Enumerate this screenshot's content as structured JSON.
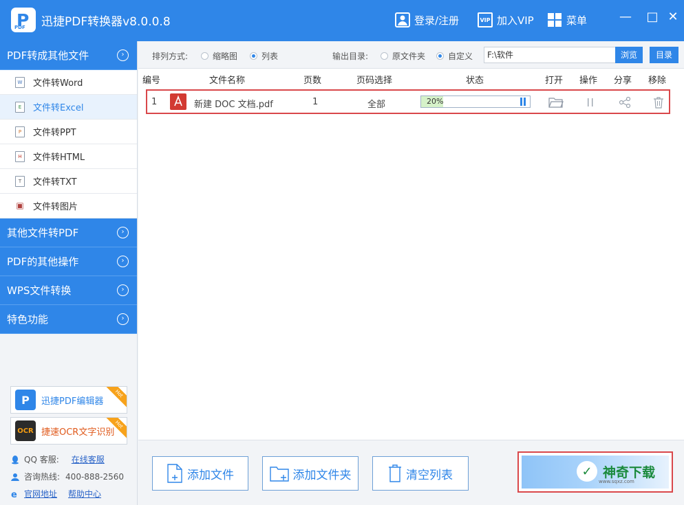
{
  "app": {
    "title": "迅捷PDF转换器v8.0.0.8",
    "logo_letter": "P",
    "logo_sub": "PDF"
  },
  "titlebar": {
    "login_label": "登录/注册",
    "vip_label": "加入VIP",
    "vip_icon_text": "VIP",
    "menu_label": "菜单",
    "minimize": "—",
    "maximize": "□",
    "close": "✕"
  },
  "sidebar": {
    "categories": [
      {
        "label": "PDF转成其他文件"
      },
      {
        "label": "其他文件转PDF"
      },
      {
        "label": "PDF的其他操作"
      },
      {
        "label": "WPS文件转换"
      },
      {
        "label": "特色功能"
      }
    ],
    "chevron": "›",
    "sub_items": [
      {
        "label": "文件转Word",
        "icon": "W"
      },
      {
        "label": "文件转Excel",
        "icon": "E"
      },
      {
        "label": "文件转PPT",
        "icon": "P"
      },
      {
        "label": "文件转HTML",
        "icon": "H"
      },
      {
        "label": "文件转TXT",
        "icon": "T"
      },
      {
        "label": "文件转图片",
        "icon": "▣"
      }
    ],
    "promos": [
      {
        "label": "迅捷PDF编辑器",
        "icon": "P",
        "ribbon": "Hot"
      },
      {
        "label": "捷速OCR文字识别",
        "icon": "OCR",
        "ribbon": "Hot"
      }
    ],
    "qq_label": "QQ 客服:",
    "qq_link": "在线客服",
    "hotline_label": "咨询热线:",
    "hotline_value": "400-888-2560",
    "site_link": "官网地址",
    "help_link": "帮助中心"
  },
  "options": {
    "sort_label": "排列方式:",
    "sort_thumb": "缩略图",
    "sort_list": "列表",
    "output_label": "输出目录:",
    "output_original": "原文件夹",
    "output_custom": "自定义",
    "path_value": "F:\\软件",
    "browse_label": "浏览",
    "dir_label": "目录"
  },
  "table": {
    "headers": [
      "编号",
      "文件名称",
      "页数",
      "页码选择",
      "状态",
      "打开",
      "操作",
      "分享",
      "移除"
    ],
    "rows": [
      {
        "index": "1",
        "name": "新建 DOC 文档.pdf",
        "pages": "1",
        "range": "全部",
        "progress_pct": 20,
        "progress_text": "20%"
      }
    ]
  },
  "bottom": {
    "add_file": "添加文件",
    "add_folder": "添加文件夹",
    "clear_list": "清空列表",
    "watermark_icon": "✓",
    "watermark_text": "神奇下载",
    "watermark_sub": "www.sqxz.com"
  },
  "colors": {
    "accent": "#2f86e8",
    "highlight_border": "#d9474a",
    "progress_fill": "#d6f2c9"
  }
}
